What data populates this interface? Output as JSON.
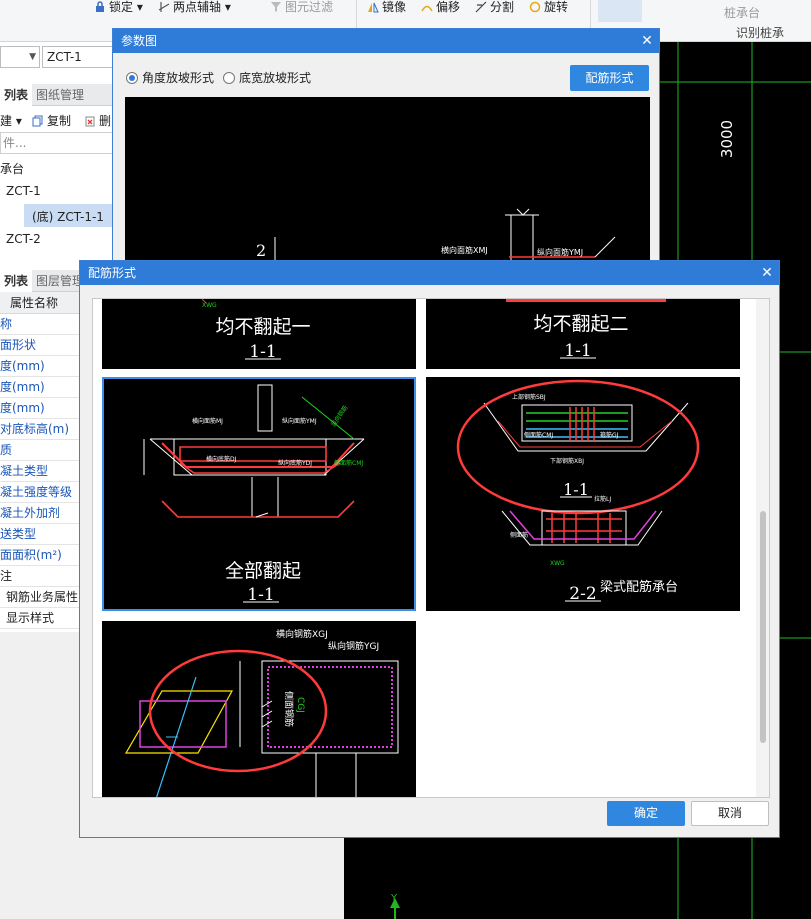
{
  "toolbar": {
    "lock": "锁定",
    "two_point_axis": "两点辅轴",
    "element_filter": "图元过滤",
    "mirror": "镜像",
    "offset": "偏移",
    "split": "分割",
    "rotate": "旋转",
    "pile_cap": "桩承台",
    "identify_group": "识别桩承"
  },
  "left_panel": {
    "floor_combo": "",
    "element_combo": "ZCT-1",
    "tab_list": "列表",
    "tab_drawings": "图纸管理",
    "new_label": "建",
    "copy_label": "复制",
    "delete_label": "删",
    "search_placeholder": "件...",
    "tree_root": "承台",
    "tree_items": [
      "ZCT-1",
      "(底) ZCT-1-1",
      "ZCT-2"
    ],
    "tab_list2": "列表",
    "tab_layers": "图层管理",
    "prop_header": "属性名称",
    "props": [
      "称",
      "面形状",
      "度(mm)",
      "度(mm)",
      "度(mm)",
      "对底标高(m)",
      "质",
      "凝土类型",
      "凝土强度等级",
      "凝土外加剂",
      "送类型",
      "面面积(m²)",
      "注",
      "钢筋业务属性",
      "显示样式"
    ]
  },
  "canvas": {
    "dimension": "3000",
    "axis_label": "Y"
  },
  "param_dialog": {
    "title": "参数图",
    "radio_angle": "角度放坡形式",
    "radio_width": "底宽放坡形式",
    "rebar_button": "配筋形式",
    "preview_dim": "2",
    "preview_labels": [
      "横向面筋XMJ",
      "纵向面筋YMJ"
    ]
  },
  "rebar_dialog": {
    "title": "配筋形式",
    "ok": "确定",
    "cancel": "取消",
    "tiles": [
      {
        "title": "均不翻起一",
        "section": "1-1",
        "small_label": "XWG"
      },
      {
        "title": "均不翻起二",
        "section": "1-1"
      },
      {
        "title": "全部翻起",
        "section": "1-1",
        "labels": [
          "横向面筋MJ",
          "纵向面筋YMJ",
          "横向底筋DJ",
          "纵向底筋YDJ",
          "侧面筋CMJ",
          "竖向钢筋"
        ]
      },
      {
        "title": "梁式配筋承台",
        "section1": "1-1",
        "section2": "2-2",
        "labels": [
          "上部钢筋SBJ",
          "侧面筋CMJ",
          "下部钢筋XBJ",
          "箍筋GJ",
          "拉筋LJ",
          "侧面筋",
          "XWG"
        ]
      },
      {
        "labels": [
          "横向钢筋XGJ",
          "纵向钢筋YGJ",
          "侧面钢筋",
          "CGJ"
        ]
      }
    ]
  },
  "colors": {
    "accent": "#2f7bd8",
    "annotation_red": "#e03030"
  }
}
